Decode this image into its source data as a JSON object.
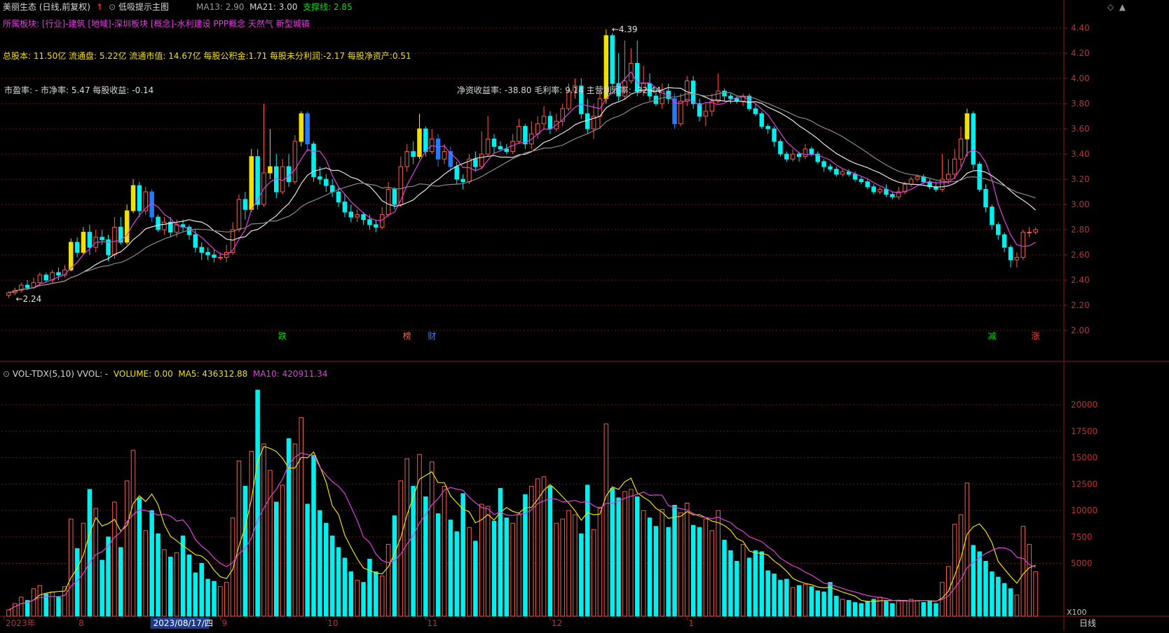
{
  "header": {
    "stock_title": "美丽生态 (日线,前复权)",
    "indicator_name": "低吸提示主图",
    "ma13": "MA13: 2.90",
    "ma21": "MA21: 3.00",
    "support": "支撑线: 2.85",
    "sectors": "所属板块: [行业]-建筑 [地域]-深圳板块 [概念]-水利建设 PPP概念 天然气 新型城镇",
    "fundamentals": "总股本: 11.50亿 流通盘: 5.22亿 流通市值: 14.67亿 每股公积金:1.71 每股未分利润:-2.17 每股净资产:0.51",
    "valuation": "市盈率: - 市净率: 5.47 每股收益: -0.14",
    "ratios": "净资收益率: -38.80 毛利率: 9.14 主营利润率: -32.44"
  },
  "volume_header": {
    "name": "VOL-TDX(5,10) VVOL: -",
    "volume": "VOLUME: 0.00",
    "ma5": "MA5: 436312.88",
    "ma10": "MA10: 420911.34"
  },
  "colors": {
    "up": "#ff5a4a",
    "down": "#00f0f0",
    "upfill": "#000000",
    "ma_white": "#e6e6e6",
    "ma_magenta": "#e040e0",
    "ma_gray": "#8a8a8a",
    "yellow": "#f0e000",
    "grid": "#7a1010",
    "axis": "#8b1a1a"
  },
  "chart_data": {
    "type": "candlestick",
    "price_axis": {
      "min": 2.0,
      "max": 4.4,
      "ticks": [
        "4.40",
        "4.20",
        "4.00",
        "3.80",
        "3.60",
        "3.40",
        "3.20",
        "3.00",
        "2.80",
        "2.60",
        "2.40",
        "2.20",
        "2.00"
      ]
    },
    "volume_axis": {
      "min": 0,
      "max": 22000,
      "ticks": [
        "20000",
        "17500",
        "15000",
        "12500",
        "10000",
        "7500",
        "5000"
      ],
      "unit": "X100"
    },
    "annotations": {
      "high": "4.39",
      "low": "2.24"
    },
    "event_markers": [
      "跌",
      "榜",
      "财",
      "减",
      "涨"
    ],
    "dates": [
      "2023年",
      "8",
      "2023/08/17/四",
      "9",
      "10",
      "11",
      "12",
      "1"
    ],
    "period": "日线",
    "candles": [
      [
        2.28,
        2.3,
        2.26,
        2.31,
        600,
        0
      ],
      [
        2.3,
        2.32,
        2.28,
        2.34,
        1200,
        0
      ],
      [
        2.32,
        2.36,
        2.3,
        2.38,
        1800,
        0
      ],
      [
        2.36,
        2.34,
        2.32,
        2.4,
        1500,
        0
      ],
      [
        2.34,
        2.38,
        2.33,
        2.42,
        2600,
        0
      ],
      [
        2.38,
        2.44,
        2.36,
        2.46,
        2900,
        0
      ],
      [
        2.44,
        2.4,
        2.38,
        2.46,
        2100,
        0
      ],
      [
        2.4,
        2.46,
        2.38,
        2.48,
        2300,
        0
      ],
      [
        2.46,
        2.44,
        2.4,
        2.5,
        1800,
        0
      ],
      [
        2.44,
        2.48,
        2.42,
        2.52,
        2800,
        0
      ],
      [
        2.48,
        2.7,
        2.47,
        2.73,
        9200,
        1
      ],
      [
        2.7,
        2.62,
        2.58,
        2.74,
        6400,
        0
      ],
      [
        2.62,
        2.78,
        2.6,
        2.82,
        8800,
        1
      ],
      [
        2.78,
        2.66,
        2.6,
        2.84,
        12000,
        0
      ],
      [
        2.66,
        2.74,
        2.62,
        2.8,
        10200,
        0
      ],
      [
        2.74,
        2.72,
        2.68,
        2.8,
        5300,
        0
      ],
      [
        2.72,
        2.6,
        2.55,
        2.76,
        7500,
        0
      ],
      [
        2.6,
        2.82,
        2.57,
        2.9,
        10800,
        0
      ],
      [
        2.82,
        2.7,
        2.68,
        2.9,
        6500,
        0
      ],
      [
        2.7,
        2.95,
        2.68,
        3.0,
        12800,
        1
      ],
      [
        2.95,
        3.15,
        2.93,
        3.2,
        15700,
        1
      ],
      [
        3.15,
        2.95,
        2.9,
        3.18,
        11200,
        0
      ],
      [
        2.95,
        3.1,
        2.92,
        3.14,
        8100,
        0
      ],
      [
        3.1,
        2.9,
        2.86,
        3.12,
        10000,
        1
      ],
      [
        2.9,
        2.8,
        2.78,
        2.92,
        7800,
        0
      ],
      [
        2.8,
        2.86,
        2.76,
        2.9,
        6300,
        0
      ],
      [
        2.86,
        2.78,
        2.74,
        2.9,
        5600,
        0
      ],
      [
        2.78,
        2.84,
        2.74,
        2.88,
        6000,
        0
      ],
      [
        2.84,
        2.82,
        2.78,
        2.88,
        7600,
        0
      ],
      [
        2.82,
        2.76,
        2.72,
        2.84,
        5800,
        0
      ],
      [
        2.76,
        2.66,
        2.62,
        2.8,
        4100,
        0
      ],
      [
        2.66,
        2.62,
        2.56,
        2.7,
        5000,
        0
      ],
      [
        2.62,
        2.6,
        2.56,
        2.66,
        3500,
        0
      ],
      [
        2.6,
        2.58,
        2.54,
        2.64,
        3300,
        0
      ],
      [
        2.58,
        2.58,
        2.56,
        2.62,
        2800,
        0
      ],
      [
        2.58,
        2.62,
        2.54,
        2.68,
        3200,
        0
      ],
      [
        2.62,
        2.8,
        2.6,
        2.86,
        9300,
        0
      ],
      [
        2.8,
        3.04,
        2.78,
        3.08,
        14700,
        0
      ],
      [
        3.04,
        2.96,
        2.88,
        3.1,
        12300,
        0
      ],
      [
        2.96,
        3.38,
        2.94,
        3.44,
        15600,
        1
      ],
      [
        3.38,
        3.0,
        2.96,
        3.44,
        21400,
        0
      ],
      [
        3.0,
        3.25,
        2.98,
        3.8,
        16300,
        0
      ],
      [
        3.25,
        3.3,
        3.2,
        3.6,
        13800,
        1
      ],
      [
        3.3,
        3.1,
        3.05,
        3.4,
        10800,
        0
      ],
      [
        3.1,
        3.3,
        3.08,
        3.36,
        12400,
        0
      ],
      [
        3.3,
        3.18,
        3.14,
        3.4,
        16800,
        0
      ],
      [
        3.18,
        3.5,
        3.16,
        3.55,
        16300,
        0
      ],
      [
        3.5,
        3.72,
        3.46,
        3.74,
        18800,
        1
      ],
      [
        3.72,
        3.48,
        3.42,
        3.74,
        10600,
        1
      ],
      [
        3.48,
        3.22,
        3.18,
        3.5,
        15200,
        0
      ],
      [
        3.22,
        3.2,
        3.16,
        3.3,
        10000,
        0
      ],
      [
        3.2,
        3.15,
        3.1,
        3.24,
        8800,
        0
      ],
      [
        3.15,
        3.1,
        3.06,
        3.2,
        7600,
        0
      ],
      [
        3.1,
        3.02,
        2.98,
        3.14,
        6500,
        0
      ],
      [
        3.02,
        2.94,
        2.9,
        3.08,
        5500,
        0
      ],
      [
        2.94,
        2.9,
        2.86,
        3.0,
        4200,
        0
      ],
      [
        2.9,
        2.92,
        2.86,
        2.96,
        3400,
        0
      ],
      [
        2.92,
        2.88,
        2.84,
        2.94,
        3200,
        0
      ],
      [
        2.88,
        2.84,
        2.8,
        2.92,
        5400,
        0
      ],
      [
        2.84,
        2.82,
        2.78,
        2.88,
        4200,
        0
      ],
      [
        2.82,
        2.92,
        2.8,
        2.98,
        3800,
        0
      ],
      [
        2.92,
        3.12,
        2.9,
        3.18,
        6800,
        0
      ],
      [
        3.12,
        3.0,
        2.96,
        3.14,
        9500,
        0
      ],
      [
        3.0,
        3.3,
        2.98,
        3.38,
        12800,
        0
      ],
      [
        3.3,
        3.42,
        3.26,
        3.48,
        14900,
        0
      ],
      [
        3.42,
        3.38,
        3.32,
        3.5,
        12300,
        0
      ],
      [
        3.38,
        3.6,
        3.36,
        3.72,
        15300,
        1
      ],
      [
        3.6,
        3.42,
        3.38,
        3.62,
        11300,
        0
      ],
      [
        3.42,
        3.52,
        3.4,
        3.6,
        14600,
        0
      ],
      [
        3.52,
        3.36,
        3.3,
        3.56,
        9700,
        1
      ],
      [
        3.36,
        3.42,
        3.32,
        3.48,
        12300,
        0
      ],
      [
        3.42,
        3.3,
        3.26,
        3.46,
        9100,
        1
      ],
      [
        3.3,
        3.2,
        3.16,
        3.34,
        8000,
        0
      ],
      [
        3.2,
        3.18,
        3.12,
        3.24,
        11600,
        0
      ],
      [
        3.18,
        3.36,
        3.16,
        3.4,
        8400,
        0
      ],
      [
        3.36,
        3.3,
        3.26,
        3.42,
        7100,
        0
      ],
      [
        3.3,
        3.4,
        3.28,
        3.58,
        10600,
        0
      ],
      [
        3.4,
        3.52,
        3.38,
        3.7,
        10400,
        0
      ],
      [
        3.52,
        3.46,
        3.4,
        3.56,
        9000,
        0
      ],
      [
        3.46,
        3.44,
        3.42,
        3.5,
        12100,
        0
      ],
      [
        3.44,
        3.42,
        3.4,
        3.48,
        9300,
        0
      ],
      [
        3.42,
        3.5,
        3.4,
        3.56,
        8800,
        0
      ],
      [
        3.5,
        3.62,
        3.48,
        3.68,
        9600,
        0
      ],
      [
        3.62,
        3.48,
        3.44,
        3.64,
        11500,
        0
      ],
      [
        3.48,
        3.56,
        3.44,
        3.66,
        12300,
        0
      ],
      [
        3.56,
        3.64,
        3.52,
        3.7,
        13000,
        0
      ],
      [
        3.64,
        3.7,
        3.6,
        3.78,
        13200,
        0
      ],
      [
        3.7,
        3.6,
        3.56,
        3.74,
        12300,
        0
      ],
      [
        3.6,
        3.66,
        3.58,
        3.72,
        8800,
        0
      ],
      [
        3.66,
        3.76,
        3.62,
        3.8,
        9200,
        0
      ],
      [
        3.76,
        3.9,
        3.74,
        3.96,
        10000,
        0
      ],
      [
        3.9,
        3.94,
        3.84,
        4.0,
        9600,
        0
      ],
      [
        3.94,
        3.72,
        3.68,
        4.0,
        7800,
        0
      ],
      [
        3.72,
        3.6,
        3.56,
        3.84,
        12400,
        0
      ],
      [
        3.6,
        3.7,
        3.52,
        3.8,
        8200,
        0
      ],
      [
        3.7,
        3.84,
        3.6,
        3.9,
        10300,
        0
      ],
      [
        3.84,
        4.34,
        3.8,
        4.39,
        18200,
        1
      ],
      [
        4.34,
        3.96,
        3.9,
        4.36,
        12100,
        0
      ],
      [
        3.96,
        3.86,
        3.82,
        4.2,
        11200,
        0
      ],
      [
        3.86,
        3.98,
        3.84,
        4.3,
        11800,
        0
      ],
      [
        3.98,
        4.12,
        3.96,
        4.24,
        12000,
        0
      ],
      [
        4.12,
        3.9,
        3.86,
        4.3,
        11300,
        0
      ],
      [
        3.9,
        3.96,
        3.86,
        4.1,
        10000,
        0
      ],
      [
        3.96,
        3.86,
        3.82,
        4.04,
        9300,
        0
      ],
      [
        3.86,
        3.8,
        3.78,
        3.92,
        8500,
        0
      ],
      [
        3.8,
        3.9,
        3.76,
        3.96,
        10100,
        0
      ],
      [
        3.9,
        3.84,
        3.8,
        3.96,
        8400,
        0
      ],
      [
        3.84,
        3.64,
        3.6,
        3.88,
        10500,
        1
      ],
      [
        3.64,
        3.82,
        3.62,
        3.88,
        9800,
        0
      ],
      [
        3.82,
        3.98,
        3.78,
        4.02,
        10700,
        0
      ],
      [
        3.98,
        3.8,
        3.76,
        4.02,
        8600,
        0
      ],
      [
        3.8,
        3.7,
        3.66,
        3.84,
        8400,
        0
      ],
      [
        3.7,
        3.74,
        3.62,
        3.8,
        9200,
        0
      ],
      [
        3.74,
        3.82,
        3.7,
        3.88,
        8100,
        0
      ],
      [
        3.82,
        3.9,
        3.8,
        4.04,
        10000,
        0
      ],
      [
        3.9,
        3.86,
        3.82,
        3.92,
        7200,
        0
      ],
      [
        3.86,
        3.84,
        3.8,
        3.88,
        6200,
        0
      ],
      [
        3.84,
        3.82,
        3.8,
        3.86,
        5200,
        0
      ],
      [
        3.82,
        3.86,
        3.78,
        3.88,
        6800,
        0
      ],
      [
        3.86,
        3.76,
        3.74,
        3.88,
        5500,
        0
      ],
      [
        3.76,
        3.72,
        3.7,
        3.8,
        6200,
        0
      ],
      [
        3.72,
        3.62,
        3.6,
        3.74,
        6100,
        0
      ],
      [
        3.62,
        3.6,
        3.56,
        3.64,
        4300,
        0
      ],
      [
        3.6,
        3.5,
        3.46,
        3.62,
        4000,
        0
      ],
      [
        3.5,
        3.4,
        3.38,
        3.52,
        3400,
        0
      ],
      [
        3.4,
        3.36,
        3.34,
        3.42,
        3500,
        0
      ],
      [
        3.36,
        3.4,
        3.34,
        3.44,
        2700,
        0
      ],
      [
        3.4,
        3.38,
        3.34,
        3.42,
        2900,
        0
      ],
      [
        3.38,
        3.44,
        3.36,
        3.48,
        3000,
        0
      ],
      [
        3.44,
        3.4,
        3.38,
        3.46,
        2800,
        0
      ],
      [
        3.4,
        3.34,
        3.32,
        3.42,
        2400,
        0
      ],
      [
        3.34,
        3.3,
        3.26,
        3.36,
        2300,
        0
      ],
      [
        3.3,
        3.28,
        3.26,
        3.32,
        3200,
        0
      ],
      [
        3.28,
        3.24,
        3.22,
        3.3,
        1900,
        0
      ],
      [
        3.24,
        3.26,
        3.22,
        3.28,
        1600,
        0
      ],
      [
        3.26,
        3.24,
        3.22,
        3.28,
        1500,
        0
      ],
      [
        3.24,
        3.2,
        3.18,
        3.26,
        1300,
        0
      ],
      [
        3.2,
        3.18,
        3.16,
        3.22,
        1200,
        0
      ],
      [
        3.18,
        3.14,
        3.12,
        3.2,
        1400,
        0
      ],
      [
        3.14,
        3.1,
        3.08,
        3.16,
        1600,
        0
      ],
      [
        3.1,
        3.12,
        3.08,
        3.14,
        1800,
        0
      ],
      [
        3.12,
        3.08,
        3.06,
        3.16,
        1400,
        0
      ],
      [
        3.08,
        3.06,
        3.04,
        3.1,
        1200,
        0
      ],
      [
        3.06,
        3.1,
        3.04,
        3.14,
        1500,
        0
      ],
      [
        3.1,
        3.16,
        3.08,
        3.18,
        1500,
        0
      ],
      [
        3.16,
        3.2,
        3.14,
        3.22,
        1600,
        0
      ],
      [
        3.2,
        3.22,
        3.18,
        3.24,
        1500,
        0
      ],
      [
        3.22,
        3.18,
        3.16,
        3.24,
        1300,
        0
      ],
      [
        3.18,
        3.14,
        3.12,
        3.2,
        1400,
        0
      ],
      [
        3.14,
        3.12,
        3.1,
        3.18,
        1200,
        0
      ],
      [
        3.12,
        3.2,
        3.1,
        3.4,
        3200,
        0
      ],
      [
        3.2,
        3.24,
        3.16,
        3.36,
        4700,
        0
      ],
      [
        3.24,
        3.36,
        3.2,
        3.44,
        8700,
        0
      ],
      [
        3.36,
        3.52,
        3.3,
        3.62,
        9600,
        0
      ],
      [
        3.52,
        3.72,
        3.38,
        3.76,
        12600,
        1
      ],
      [
        3.72,
        3.32,
        3.28,
        3.74,
        6700,
        0
      ],
      [
        3.32,
        3.12,
        3.1,
        3.34,
        6100,
        0
      ],
      [
        3.12,
        2.98,
        2.94,
        3.16,
        5200,
        0
      ],
      [
        2.98,
        2.84,
        2.8,
        3.0,
        4200,
        0
      ],
      [
        2.84,
        2.76,
        2.72,
        2.86,
        3700,
        0
      ],
      [
        2.76,
        2.66,
        2.62,
        2.78,
        3100,
        0
      ],
      [
        2.66,
        2.56,
        2.5,
        2.68,
        2600,
        0
      ],
      [
        2.56,
        2.58,
        2.5,
        2.62,
        2000,
        0
      ],
      [
        2.58,
        2.78,
        2.56,
        2.8,
        8500,
        0
      ],
      [
        2.78,
        2.78,
        2.74,
        2.82,
        6800,
        0
      ],
      [
        2.78,
        2.8,
        2.76,
        2.82,
        4200,
        0
      ]
    ]
  }
}
